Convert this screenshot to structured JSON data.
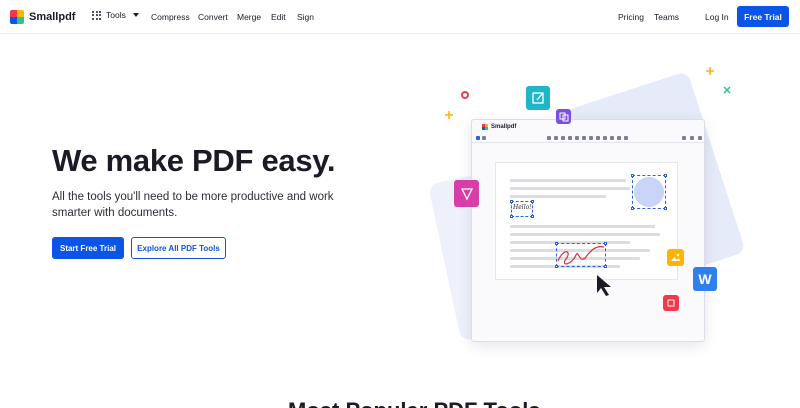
{
  "brand": {
    "name": "Smallpdf",
    "colors": [
      "#f03a4b",
      "#ffb400",
      "#0a55e7",
      "#2bc48a"
    ]
  },
  "nav": {
    "tools_label": "Tools",
    "links": [
      "Compress",
      "Convert",
      "Merge",
      "Edit",
      "Sign"
    ],
    "right_links": [
      "Pricing",
      "Teams"
    ],
    "login_label": "Log In",
    "trial_label": "Free Trial"
  },
  "hero": {
    "title": "We make PDF easy.",
    "subtitle": "All the tools you'll need to be more productive and work smarter with documents.",
    "primary_cta": "Start Free Trial",
    "secondary_cta": "Explore All PDF Tools"
  },
  "illustration": {
    "app_title": "Smallpdf",
    "doc_text": "Hello!",
    "icons": [
      "edit-pdf-icon",
      "copy-icon",
      "pdf-sign-icon",
      "image-icon",
      "word-icon",
      "crop-icon",
      "cursor-icon"
    ]
  },
  "section": {
    "heading": "Most Popular PDF Tools"
  },
  "colors": {
    "accent": "#0a55e7",
    "text": "#1b1b26"
  }
}
